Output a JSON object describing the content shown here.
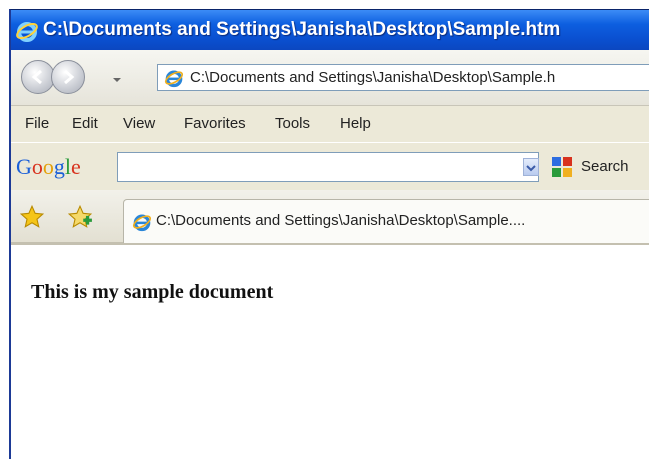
{
  "window": {
    "title": "C:\\Documents and Settings\\Janisha\\Desktop\\Sample.htm"
  },
  "navbar": {
    "address": "C:\\Documents and Settings\\Janisha\\Desktop\\Sample.h"
  },
  "menu": {
    "items": [
      "File",
      "Edit",
      "View",
      "Favorites",
      "Tools",
      "Help"
    ]
  },
  "google": {
    "logo_letters": [
      "G",
      "o",
      "o",
      "g",
      "l",
      "e"
    ],
    "logo_colors": [
      "#1a5fd8",
      "#d8321e",
      "#e3a10b",
      "#1a5fd8",
      "#2a9b3b",
      "#d8321e"
    ],
    "search_label": "Search",
    "input_value": ""
  },
  "tabbar": {
    "tab_title": "C:\\Documents and Settings\\Janisha\\Desktop\\Sample...."
  },
  "content": {
    "text": "This is my sample document"
  },
  "icons": [
    "ie-icon",
    "back-arrow-icon",
    "forward-arrow-icon",
    "chevron-down-icon",
    "favorites-star-icon",
    "add-favorites-icon",
    "google-icon"
  ]
}
